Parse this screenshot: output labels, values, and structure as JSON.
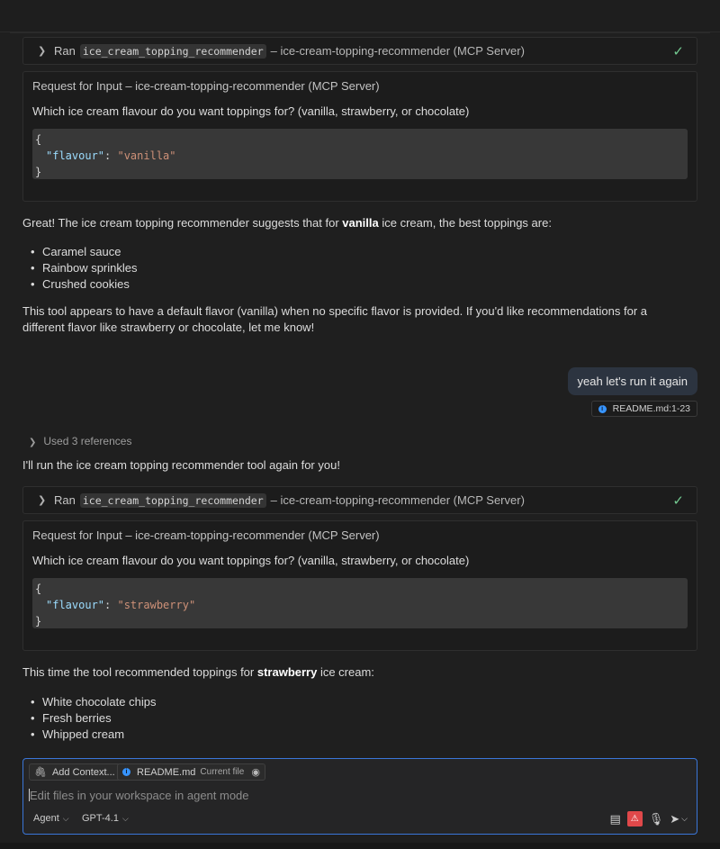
{
  "tool_calls": [
    {
      "ran_label": "Ran",
      "tool_name": "ice_cream_topping_recommender",
      "server": "– ice-cream-topping-recommender (MCP Server)",
      "request_title": "Request for Input – ice-cream-topping-recommender (MCP Server)",
      "question": "Which ice cream flavour do you want toppings for? (vanilla, strawberry, or chocolate)",
      "json_open": "{",
      "json_key": "\"flavour\"",
      "json_colon": ": ",
      "json_value": "\"vanilla\"",
      "json_close": "}"
    },
    {
      "ran_label": "Ran",
      "tool_name": "ice_cream_topping_recommender",
      "server": "– ice-cream-topping-recommender (MCP Server)",
      "request_title": "Request for Input – ice-cream-topping-recommender (MCP Server)",
      "question": "Which ice cream flavour do you want toppings for? (vanilla, strawberry, or chocolate)",
      "json_open": "{",
      "json_key": "\"flavour\"",
      "json_colon": ": ",
      "json_value": "\"strawberry\"",
      "json_close": "}"
    }
  ],
  "response1": {
    "intro_before": "Great! The ice cream topping recommender suggests that for ",
    "intro_bold": "vanilla",
    "intro_after": " ice cream, the best toppings are:",
    "items": [
      "Caramel sauce",
      "Rainbow sprinkles",
      "Crushed cookies"
    ],
    "note": "This tool appears to have a default flavor (vanilla) when no specific flavor is provided. If you'd like recommendations for a different flavor like strawberry or chocolate, let me know!"
  },
  "user_message": {
    "text": "yeah let's run it again",
    "reference": "README.md:1-23"
  },
  "used_refs": "Used 3 references",
  "response2_intro": "I'll run the ice cream topping recommender tool again for you!",
  "response3": {
    "intro_before": "This time the tool recommended toppings for ",
    "intro_bold": "strawberry",
    "intro_after": " ice cream:",
    "items": [
      "White chocolate chips",
      "Fresh berries",
      "Whipped cream"
    ]
  },
  "composer": {
    "add_context": "Add Context...",
    "file_chip": "README.md",
    "file_chip_sub": "Current file",
    "placeholder": "Edit files in your workspace in agent mode",
    "mode": "Agent",
    "model": "GPT-4.1"
  },
  "colors": {
    "accent": "#3a76d8",
    "check": "#73c991",
    "warning": "#e0484a",
    "json_key": "#9cdcfe",
    "json_string": "#ce9178"
  },
  "icons": {
    "expand": "chevron-right-icon",
    "done": "check-icon",
    "attach": "paperclip-icon",
    "info": "info-icon",
    "preview": "eye-icon",
    "tools": "tools-icon",
    "warn": "warning-icon",
    "mic": "microphone-icon",
    "send": "send-icon"
  }
}
